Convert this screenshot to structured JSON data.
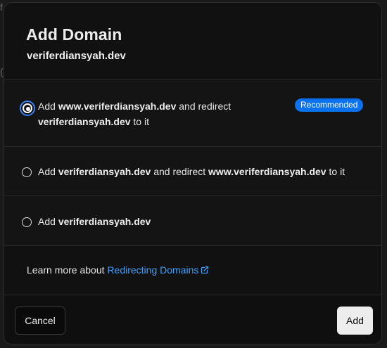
{
  "modal": {
    "title": "Add Domain",
    "domain": "veriferdiansyah.dev"
  },
  "options": [
    {
      "selected": true,
      "prefix": "Add",
      "primary": "www.veriferdiansyah.dev",
      "middle": "and redirect",
      "secondary": "veriferdiansyah.dev",
      "suffix": "to it",
      "badge": "Recommended"
    },
    {
      "selected": false,
      "prefix": "Add",
      "primary": "veriferdiansyah.dev",
      "middle": "and redirect",
      "secondary": "www.veriferdiansyah.dev",
      "suffix": "to it"
    },
    {
      "selected": false,
      "prefix": "Add",
      "primary": "veriferdiansyah.dev"
    }
  ],
  "learn_more": {
    "text": "Learn more about",
    "link_label": "Redirecting Domains",
    "icon": "external-link-icon"
  },
  "footer": {
    "cancel_label": "Cancel",
    "add_label": "Add"
  },
  "colors": {
    "accent_blue": "#0a72ef",
    "link_blue": "#3ea0ff",
    "background": "#0a0a0a"
  }
}
